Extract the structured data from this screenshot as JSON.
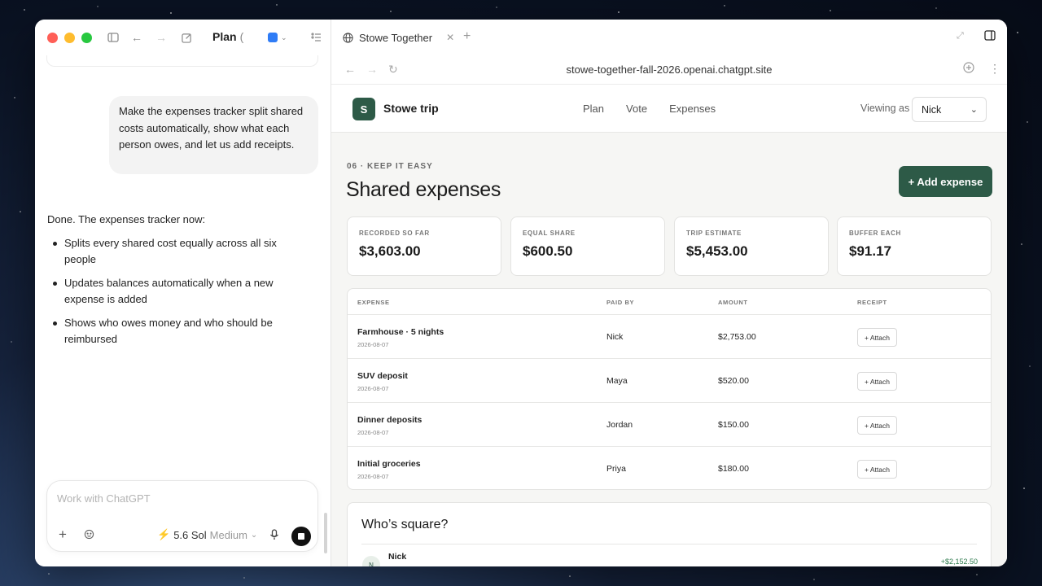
{
  "left_panel": {
    "title": "Plan",
    "title_suffix": "(",
    "user_message": "Make the expenses tracker split shared costs automatically, show what each person owes, and let us add receipts.",
    "assistant_intro": "Done. The expenses tracker now:",
    "assistant_bullets": [
      "Splits every shared cost equally across all six people",
      "Updates balances automatically when a new expense is added",
      "Shows who owes money and who should be reimbursed"
    ],
    "composer": {
      "placeholder": "Work with ChatGPT",
      "model": "5.6 Sol",
      "level": "Medium"
    }
  },
  "browser": {
    "tab_title": "Stowe Together",
    "url": "stowe-together-fall-2026.openai.chatgpt.site"
  },
  "site": {
    "logo_letter": "S",
    "brand": "Stowe trip",
    "nav": [
      "Plan",
      "Vote",
      "Expenses"
    ],
    "viewing_label": "Viewing as",
    "viewing_value": "Nick",
    "eyebrow": "06 · KEEP IT EASY",
    "heading": "Shared expenses",
    "add_button": "+ Add expense",
    "stats": [
      {
        "label": "RECORDED SO FAR",
        "value": "$3,603.00"
      },
      {
        "label": "EQUAL SHARE",
        "value": "$600.50"
      },
      {
        "label": "TRIP ESTIMATE",
        "value": "$5,453.00"
      },
      {
        "label": "BUFFER EACH",
        "value": "$91.17"
      }
    ],
    "table": {
      "headers": [
        "EXPENSE",
        "PAID BY",
        "AMOUNT",
        "RECEIPT"
      ],
      "attach_label": "+ Attach",
      "rows": [
        {
          "name": "Farmhouse · 5 nights",
          "date": "2026-08-07",
          "payer": "Nick",
          "amount": "$2,753.00"
        },
        {
          "name": "SUV deposit",
          "date": "2026-08-07",
          "payer": "Maya",
          "amount": "$520.00"
        },
        {
          "name": "Dinner deposits",
          "date": "2026-08-07",
          "payer": "Jordan",
          "amount": "$150.00"
        },
        {
          "name": "Initial groceries",
          "date": "2026-08-07",
          "payer": "Priya",
          "amount": "$180.00"
        }
      ]
    },
    "square": {
      "title": "Who’s square?",
      "person_initial": "N",
      "person_name": "Nick",
      "person_balance": "+$2,152.50"
    }
  },
  "colors": {
    "accent": "#2d5a47",
    "close": "#ff5f57",
    "minimize": "#febc2e",
    "maximize": "#28c840"
  }
}
